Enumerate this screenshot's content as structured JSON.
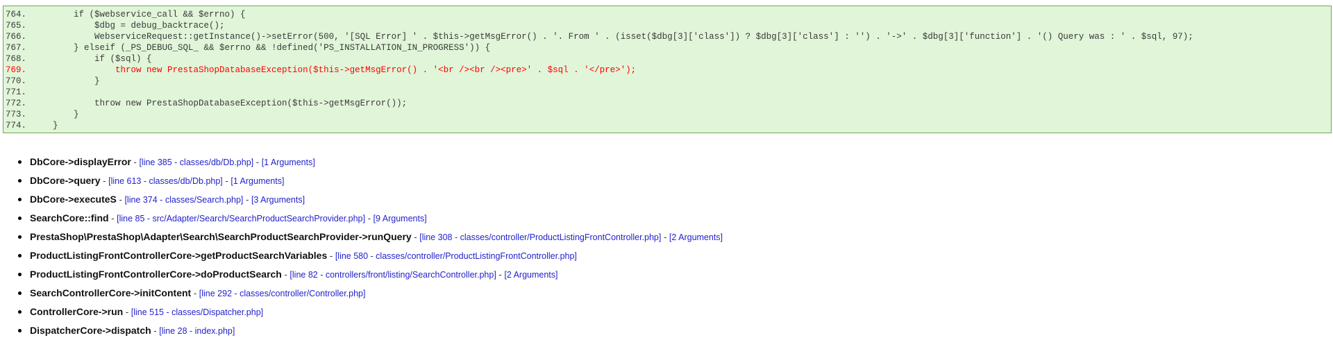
{
  "code": {
    "lines": [
      {
        "num": "764.",
        "text": "        if ($webservice_call && $errno) {",
        "highlight": false
      },
      {
        "num": "765.",
        "text": "            $dbg = debug_backtrace();",
        "highlight": false
      },
      {
        "num": "766.",
        "text": "            WebserviceRequest::getInstance()->setError(500, '[SQL Error] ' . $this->getMsgError() . '. From ' . (isset($dbg[3]['class']) ? $dbg[3]['class'] : '') . '->' . $dbg[3]['function'] . '() Query was : ' . $sql, 97);",
        "highlight": false
      },
      {
        "num": "767.",
        "text": "        } elseif (_PS_DEBUG_SQL_ && $errno && !defined('PS_INSTALLATION_IN_PROGRESS')) {",
        "highlight": false
      },
      {
        "num": "768.",
        "text": "            if ($sql) {",
        "highlight": false
      },
      {
        "num": "769.",
        "text": "                throw new PrestaShopDatabaseException($this->getMsgError() . '<br /><br /><pre>' . $sql . '</pre>');",
        "highlight": true
      },
      {
        "num": "770.",
        "text": "            }",
        "highlight": false
      },
      {
        "num": "771.",
        "text": "",
        "highlight": false
      },
      {
        "num": "772.",
        "text": "            throw new PrestaShopDatabaseException($this->getMsgError());",
        "highlight": false
      },
      {
        "num": "773.",
        "text": "        }",
        "highlight": false
      },
      {
        "num": "774.",
        "text": "    }",
        "highlight": false
      }
    ]
  },
  "trace": [
    {
      "fn": "DbCore->displayError",
      "location": "[line 385 - classes/db/Db.php]",
      "args": "[1 Arguments]"
    },
    {
      "fn": "DbCore->query",
      "location": "[line 613 - classes/db/Db.php]",
      "args": "[1 Arguments]"
    },
    {
      "fn": "DbCore->executeS",
      "location": "[line 374 - classes/Search.php]",
      "args": "[3 Arguments]"
    },
    {
      "fn": "SearchCore::find",
      "location": "[line 85 - src/Adapter/Search/SearchProductSearchProvider.php]",
      "args": "[9 Arguments]"
    },
    {
      "fn": "PrestaShop\\PrestaShop\\Adapter\\Search\\SearchProductSearchProvider->runQuery",
      "location": "[line 308 - classes/controller/ProductListingFrontController.php]",
      "args": "[2 Arguments]"
    },
    {
      "fn": "ProductListingFrontControllerCore->getProductSearchVariables",
      "location": "[line 580 - classes/controller/ProductListingFrontController.php]",
      "args": null
    },
    {
      "fn": "ProductListingFrontControllerCore->doProductSearch",
      "location": "[line 82 - controllers/front/listing/SearchController.php]",
      "args": "[2 Arguments]"
    },
    {
      "fn": "SearchControllerCore->initContent",
      "location": "[line 292 - classes/controller/Controller.php]",
      "args": null
    },
    {
      "fn": "ControllerCore->run",
      "location": "[line 515 - classes/Dispatcher.php]",
      "args": null
    },
    {
      "fn": "DispatcherCore->dispatch",
      "location": "[line 28 - index.php]",
      "args": null
    }
  ],
  "separator": " - "
}
